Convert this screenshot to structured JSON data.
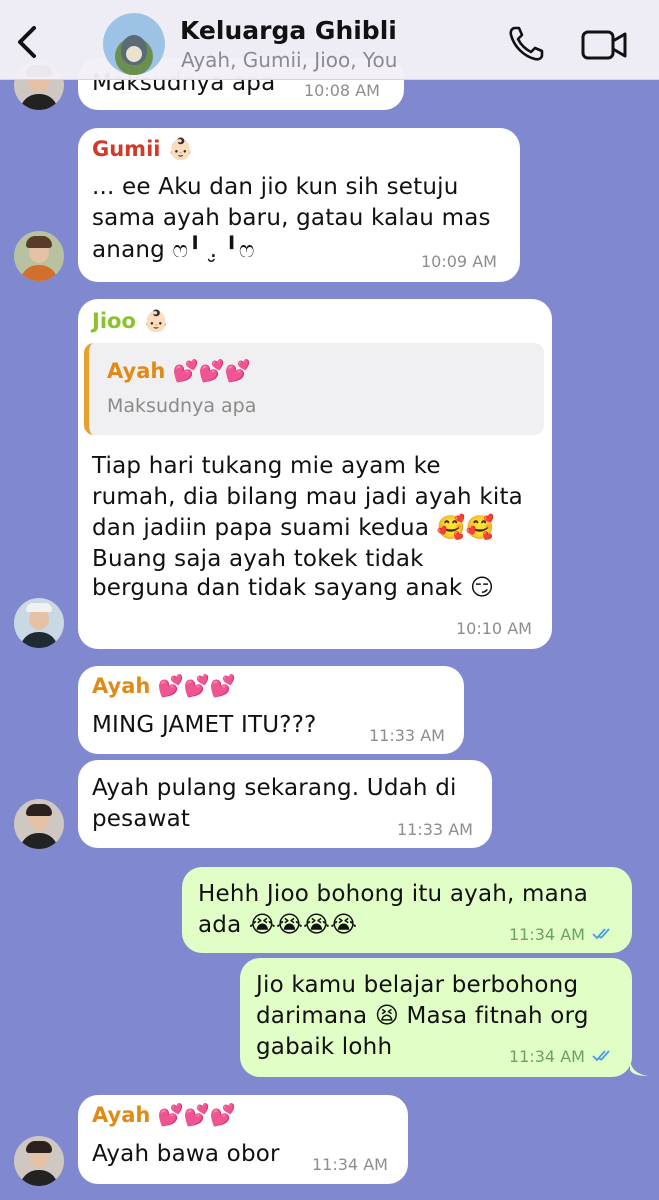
{
  "header": {
    "title": "Keluarga Ghibli",
    "members": "Ayah, Gumii, Jioo, You"
  },
  "messages": [
    {
      "text": "Maksudnya apa",
      "time": "10:08 AM"
    },
    {
      "sender": "Gumii 👶🏻",
      "lines": [
        "... ee Aku dan jio kun sih setuju",
        "sama ayah baru, gatau kalau mas",
        "anang ෆ╹ .̮ ╹ෆ"
      ],
      "time": "10:09 AM"
    },
    {
      "sender": "Jioo 👶🏻",
      "quote_name": "Ayah 💕💕💕",
      "quote_text": "Maksudnya apa",
      "lines": [
        "Tiap hari tukang mie ayam ke",
        "rumah, dia bilang mau jadi ayah kita",
        "dan jadiin papa suami kedua 🥰🥰",
        "Buang saja ayah tokek tidak",
        "berguna dan tidak sayang anak 😏"
      ],
      "time": "10:10 AM"
    },
    {
      "sender": "Ayah 💕💕💕",
      "lines": [
        "MING JAMET ITU???"
      ],
      "time": "11:33 AM"
    },
    {
      "lines": [
        "Ayah pulang sekarang. Udah di",
        "pesawat"
      ],
      "time": "11:33 AM"
    },
    {
      "lines": [
        "Hehh Jioo bohong itu ayah, mana",
        "ada 😭😭😭😭"
      ],
      "time": "11:34 AM"
    },
    {
      "lines": [
        "Jio kamu belajar berbohong",
        "darimana 😫 Masa fitnah org",
        "gabaik lohh"
      ],
      "time": "11:34 AM"
    },
    {
      "sender": "Ayah 💕💕💕",
      "lines": [
        "Ayah bawa obor"
      ],
      "time": "11:34 AM"
    }
  ],
  "colors": {
    "background": "#8088cf",
    "incoming": "#ffffff",
    "outgoing": "#e1fec6",
    "gumii": "#d13a2a",
    "jioo": "#8ac22c",
    "ayah": "#e08b17",
    "read_ticks": "#4a9be3"
  }
}
